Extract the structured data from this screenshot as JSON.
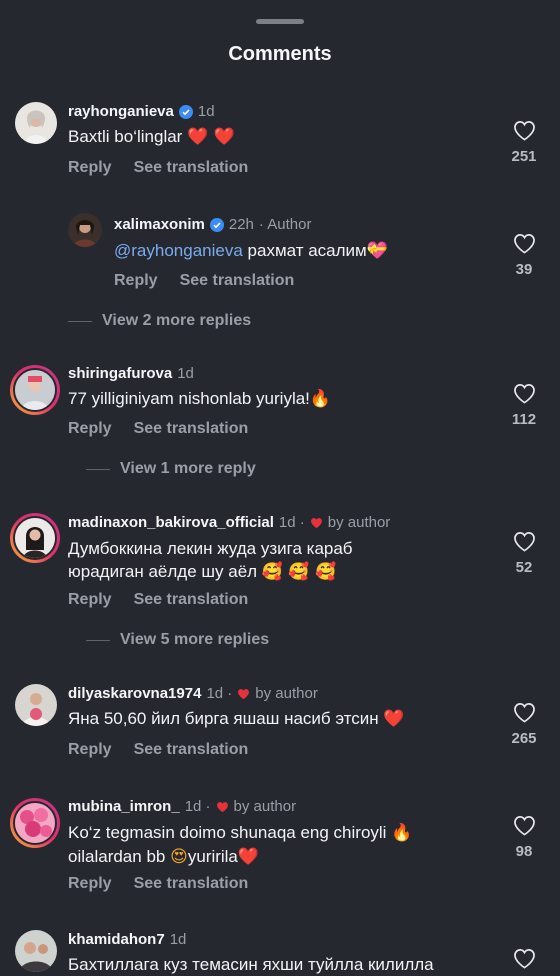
{
  "header": {
    "title": "Comments"
  },
  "comments": [
    {
      "user": "rayhonganieva",
      "time": "1d",
      "verified": true,
      "extra": "",
      "text": "Baxtli bo‘linglar",
      "emoji": "❤️ ❤️",
      "reply": "Reply",
      "translate": "See translation",
      "likes": "251"
    },
    {
      "user": "xalimaxonim",
      "time": "22h",
      "verified": true,
      "extra": "· Author",
      "mention": "@rayhonganieva",
      "text": "рахмат асалим",
      "emoji": "💝",
      "reply": "Reply",
      "translate": "See translation",
      "likes": "39"
    },
    {
      "user": "shiringafurova",
      "time": "1d",
      "verified": false,
      "extra": "",
      "text": "77 yilliginiyam nishonlab yuriyla!",
      "emoji": "🔥",
      "reply": "Reply",
      "translate": "See translation",
      "likes": "112"
    },
    {
      "user": "madinaxon_bakirova_official",
      "time": "1d ·",
      "verified": false,
      "extra": "by author",
      "text": "Думбоккина лекин жуда узига караб",
      "text2": "юрадиган аёлде шу аёл",
      "emoji": "🥰 🥰 🥰",
      "reply": "Reply",
      "translate": "See translation",
      "likes": "52"
    },
    {
      "user": "dilyaskarovna1974",
      "time": "1d ·",
      "verified": false,
      "extra": "by author",
      "text": "Яна 50,60 йил бирга яшаш насиб этсин",
      "emoji": "❤️",
      "reply": "Reply",
      "translate": "See translation",
      "likes": "265"
    },
    {
      "user": "mubina_imron_",
      "time": "1d ·",
      "verified": false,
      "extra": "by author",
      "text": "Ko‘z tegmasin doimo shunaqa eng chiroyli",
      "emoji": "🔥",
      "text2": "oilalardan bb",
      "emoji2": "😍",
      "text2b": "yuririla",
      "emoji3": "❤️",
      "reply": "Reply",
      "translate": "See translation",
      "likes": "98"
    },
    {
      "user": "khamidahon7",
      "time": "1d",
      "verified": false,
      "extra": "",
      "text": "Бахтиллага куз темасин яхши туйлла килилла"
    }
  ],
  "view_more": [
    "View 2 more replies",
    "View 1 more reply",
    "View 5 more replies"
  ],
  "colors": {
    "background": "#25292f",
    "verified": "#3b8cf5",
    "heart": "#e5323b",
    "link": "#7aaaf0"
  }
}
